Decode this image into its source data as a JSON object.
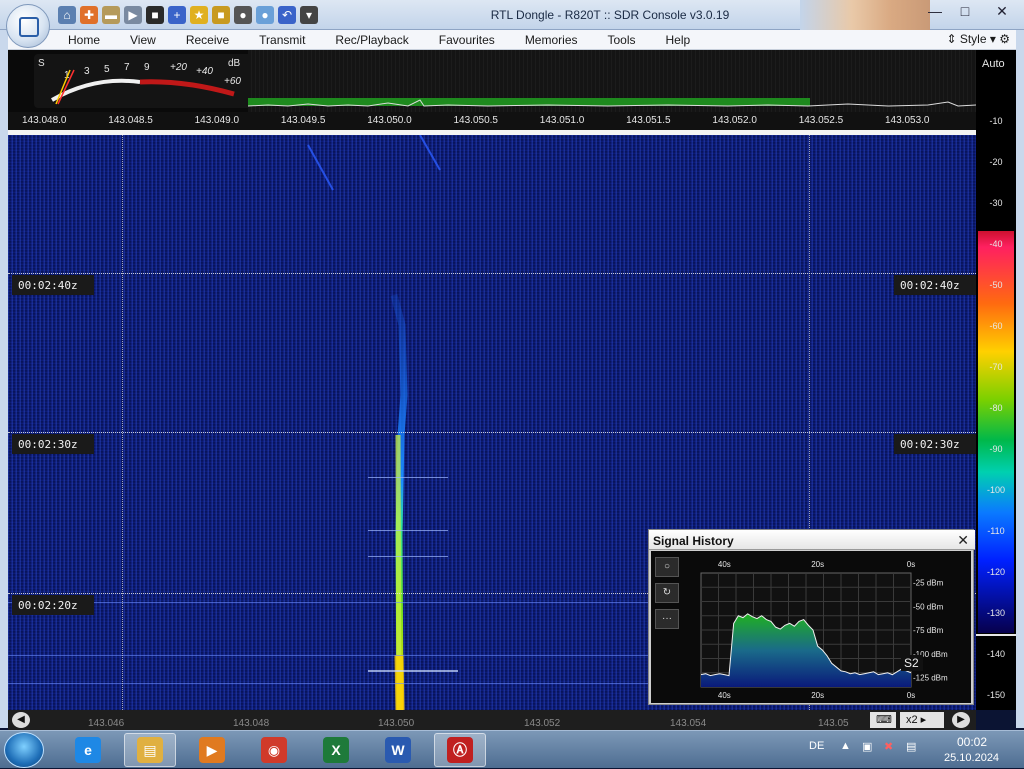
{
  "window": {
    "title": "RTL Dongle - R820T :: SDR Console v3.0.19",
    "controls": {
      "minimize": "—",
      "maximize": "□",
      "close": "✕"
    }
  },
  "quick_access": [
    {
      "name": "home-icon",
      "glyph": "⌂",
      "color": "#5b7fb0"
    },
    {
      "name": "lifebuoy-icon",
      "glyph": "✚",
      "color": "#e0702a"
    },
    {
      "name": "folder-icon",
      "glyph": "▬",
      "color": "#b59a5a"
    },
    {
      "name": "play-icon",
      "glyph": "▶",
      "color": "#7a8aa0"
    },
    {
      "name": "stop-icon",
      "glyph": "■",
      "color": "#2a2a2a"
    },
    {
      "name": "add-icon",
      "glyph": "+",
      "color": "#3a63c9"
    },
    {
      "name": "star-icon",
      "glyph": "★",
      "color": "#e0b020"
    },
    {
      "name": "lock-icon",
      "glyph": "■",
      "color": "#c89a20"
    },
    {
      "name": "camera-icon",
      "glyph": "●",
      "color": "#555"
    },
    {
      "name": "drop-icon",
      "glyph": "●",
      "color": "#6aa0d8"
    },
    {
      "name": "undo-icon",
      "glyph": "↶",
      "color": "#3a63c9"
    },
    {
      "name": "dropdown-icon",
      "glyph": "▾",
      "color": "#444"
    }
  ],
  "menu": {
    "items": [
      "Home",
      "View",
      "Receive",
      "Transmit",
      "Rec/Playback",
      "Favourites",
      "Memories",
      "Tools",
      "Help"
    ],
    "style_label": "Style"
  },
  "smeter": {
    "s_label": "S",
    "db_label": "dB",
    "scale": [
      "1",
      "3",
      "5",
      "7",
      "9",
      "+20",
      "+40",
      "+60"
    ]
  },
  "frequency_axis": {
    "ticks": [
      "143.048.0",
      "143.048.5",
      "143.049.0",
      "143.049.5",
      "143.050.0",
      "143.050.5",
      "143.051.0",
      "143.051.5",
      "143.052.0",
      "143.052.5",
      "143.053.0"
    ]
  },
  "waterfall": {
    "time_markers": [
      "00:02:40z",
      "00:02:30z",
      "00:02:20z"
    ]
  },
  "color_scale": {
    "auto_label": "Auto",
    "ticks": [
      "-10",
      "-20",
      "-30",
      "-40",
      "-50",
      "-60",
      "-70",
      "-80",
      "-90",
      "-100",
      "-110",
      "-120",
      "-130",
      "-140",
      "-150"
    ],
    "marker_level": "-40"
  },
  "signal_history": {
    "title": "Signal History",
    "close_glyph": "✕",
    "buttons": [
      "○",
      "↻",
      "···"
    ],
    "x_top": [
      "40s",
      "20s",
      "0s"
    ],
    "x_bottom": [
      "40s",
      "20s",
      "0s"
    ],
    "y_labels": [
      "-25 dBm",
      "-50 dBm",
      "-75 dBm",
      "-100 dBm",
      "-125 dBm"
    ],
    "s_badge": "S2",
    "chart_data": {
      "type": "area",
      "xlabel": "",
      "ylabel": "",
      "x_unit": "seconds ago",
      "xlim": [
        45,
        0
      ],
      "ylim": [
        -135,
        -15
      ],
      "x": [
        45,
        44,
        43,
        42,
        41,
        40,
        39,
        38,
        37,
        36,
        35,
        34,
        33,
        32,
        31,
        30,
        29,
        28,
        27,
        26,
        25,
        24,
        23,
        22,
        21,
        20,
        19,
        18,
        17,
        16,
        15,
        14,
        13,
        12,
        11,
        10,
        9,
        8,
        7,
        6,
        5,
        4,
        3,
        2,
        1,
        0
      ],
      "values": [
        -122,
        -121,
        -123,
        -122,
        -121,
        -122,
        -123,
        -68,
        -60,
        -62,
        -58,
        -61,
        -63,
        -60,
        -64,
        -66,
        -72,
        -74,
        -70,
        -68,
        -71,
        -66,
        -64,
        -70,
        -75,
        -92,
        -96,
        -102,
        -110,
        -114,
        -118,
        -119,
        -121,
        -120,
        -122,
        -121,
        -120,
        -119,
        -122,
        -121,
        -120,
        -122,
        -119,
        -116,
        -118,
        -120
      ]
    }
  },
  "bottom_axis": {
    "labels": [
      "143.046",
      "143.048",
      "143.050",
      "143.052",
      "143.054",
      "143.05"
    ],
    "zoom_label": "x2"
  },
  "taskbar": {
    "apps": [
      {
        "name": "ie-icon",
        "glyph": "e",
        "color": "#1e88e5"
      },
      {
        "name": "explorer-icon",
        "glyph": "▤",
        "color": "#e0b040"
      },
      {
        "name": "media-player-icon",
        "glyph": "▶",
        "color": "#e07a20"
      },
      {
        "name": "chrome-icon",
        "glyph": "◉",
        "color": "#d03a2a"
      },
      {
        "name": "excel-icon",
        "glyph": "X",
        "color": "#1e7a3a"
      },
      {
        "name": "word-icon",
        "glyph": "W",
        "color": "#2a5ab0"
      },
      {
        "name": "sdr-console-icon",
        "glyph": "Ⓐ",
        "color": "#c02020"
      }
    ],
    "language": "DE",
    "time": "00:02",
    "date": "25.10.2024"
  }
}
